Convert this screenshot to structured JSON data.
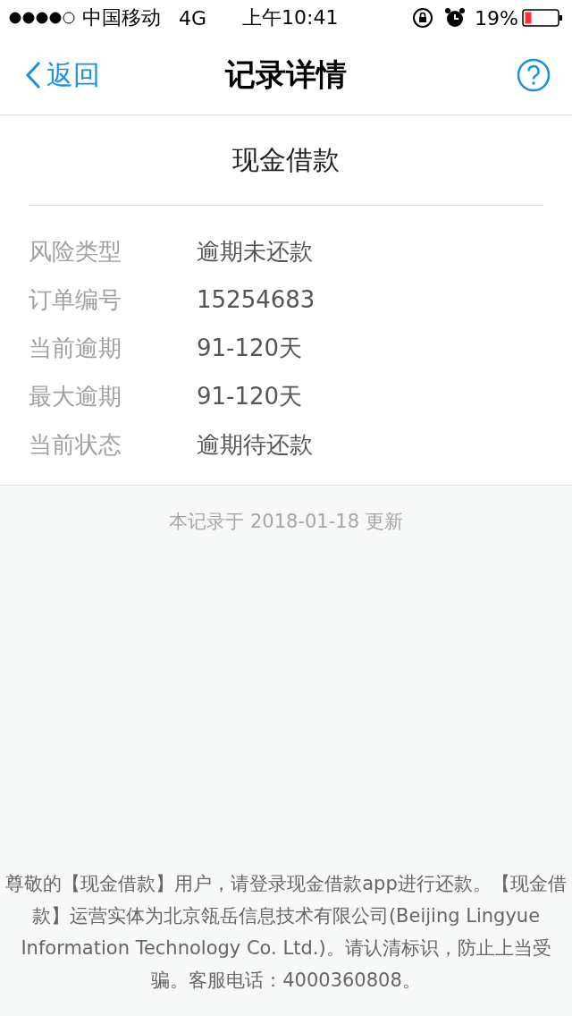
{
  "status_bar": {
    "carrier": "中国移动",
    "network": "4G",
    "time": "上午10:41",
    "battery": "19%"
  },
  "nav": {
    "back": "返回",
    "title": "记录详情"
  },
  "record": {
    "title": "现金借款",
    "fields": [
      {
        "label": "风险类型",
        "value": "逾期未还款"
      },
      {
        "label": "订单编号",
        "value": "15254683"
      },
      {
        "label": "当前逾期",
        "value": "91-120天"
      },
      {
        "label": "最大逾期",
        "value": "91-120天"
      },
      {
        "label": "当前状态",
        "value": "逾期待还款"
      }
    ]
  },
  "update_note": "本记录于 2018-01-18 更新",
  "footer_notice": "尊敬的【现金借款】用户，请登录现金借款app进行还款。【现金借款】运营实体为北京瓴岳信息技术有限公司(Beijing Lingyue Information Technology Co. Ltd.)。请认清标识，防止上当受骗。客服电话：4000360808。"
}
